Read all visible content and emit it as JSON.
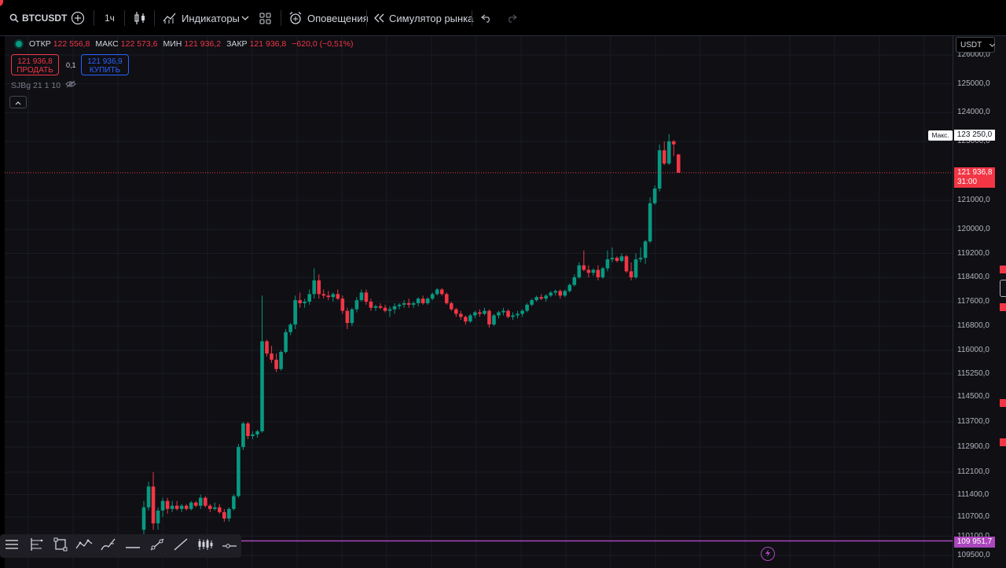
{
  "toolbar": {
    "symbol": "BTCUSDT",
    "interval": "1ч",
    "indicators_label": "Индикаторы",
    "alerts_label": "Оповещения",
    "replay_label": "Симулятор рынка"
  },
  "ohlc": {
    "open_label": "ОТКР",
    "open": "122 556,8",
    "high_label": "МАКС",
    "high": "122 573,6",
    "low_label": "МИН",
    "low": "121 936,2",
    "close_label": "ЗАКР",
    "close": "121 936,8",
    "change": "−620,0 (−0,51%)"
  },
  "trade": {
    "sell_price": "121 936,8",
    "sell_label": "ПРОДАТЬ",
    "spread": "0,1",
    "buy_price": "121 936,9",
    "buy_label": "КУПИТЬ"
  },
  "indicator_legend": "SJBg 21 1 10",
  "currency": "USDT",
  "price_axis": {
    "ticks": [
      "126000,0",
      "125000,0",
      "124000,0",
      "123000,0",
      "121000,0",
      "120000,0",
      "119200,0",
      "118400,0",
      "117600,0",
      "116800,0",
      "116000,0",
      "115250,0",
      "114500,0",
      "113700,0",
      "112900,0",
      "112100,0",
      "111400,0",
      "110700,0",
      "110100,0",
      "109500,0"
    ],
    "tick_values": [
      126000,
      125000,
      124000,
      123000,
      121000,
      120000,
      119200,
      118400,
      117600,
      116800,
      116000,
      115250,
      114500,
      113700,
      112900,
      112100,
      111400,
      110700,
      110100,
      109500
    ],
    "max_label": "Макс.",
    "max_value": "123 250,0",
    "current_price": "121 936,8",
    "countdown": "31:00",
    "horizontal_line_price": "109 951,7"
  },
  "colors": {
    "up": "#089981",
    "down": "#f23645",
    "horizontal_line": "#ab47bc",
    "background": "#0f0f14"
  },
  "drawing_tools": [
    "menu-icon",
    "fib-icon",
    "rectangle-icon",
    "path-icon",
    "brush-icon",
    "horizontal-line-icon",
    "trend-line-icon",
    "ray-icon",
    "pattern-icon",
    "horizontal-ray-icon"
  ],
  "chart_data": {
    "type": "candlestick",
    "interval": "1h",
    "symbol": "BTCUSDT",
    "ylim": [
      109400,
      126300
    ],
    "candles": [
      [
        110300,
        111200,
        110100,
        111000
      ],
      [
        111000,
        111800,
        110900,
        111650
      ],
      [
        111650,
        112100,
        110300,
        110500
      ],
      [
        110500,
        111000,
        110300,
        110900
      ],
      [
        110900,
        111300,
        110700,
        111200
      ],
      [
        111200,
        111300,
        110800,
        110950
      ],
      [
        110950,
        111200,
        110850,
        111050
      ],
      [
        111050,
        111200,
        110900,
        110950
      ],
      [
        110950,
        111100,
        110850,
        111050
      ],
      [
        111050,
        111100,
        110900,
        110950
      ],
      [
        110950,
        111200,
        110900,
        111150
      ],
      [
        111150,
        111200,
        111000,
        111050
      ],
      [
        111050,
        111400,
        110950,
        111300
      ],
      [
        111300,
        111350,
        111000,
        111050
      ],
      [
        111050,
        111100,
        110850,
        110950
      ],
      [
        110950,
        111150,
        110900,
        111000
      ],
      [
        111000,
        111100,
        110800,
        110850
      ],
      [
        110850,
        110950,
        110550,
        110650
      ],
      [
        110650,
        111000,
        110550,
        110950
      ],
      [
        110950,
        111400,
        110900,
        111350
      ],
      [
        111350,
        113000,
        111300,
        112900
      ],
      [
        112900,
        113700,
        112800,
        113650
      ],
      [
        113650,
        113700,
        113150,
        113250
      ],
      [
        113250,
        113400,
        113150,
        113300
      ],
      [
        113300,
        113450,
        113200,
        113400
      ],
      [
        113400,
        117800,
        113350,
        116300
      ],
      [
        116300,
        116350,
        115800,
        115900
      ],
      [
        115900,
        116150,
        115600,
        115700
      ],
      [
        115700,
        115900,
        115300,
        115400
      ],
      [
        115400,
        116000,
        115350,
        115950
      ],
      [
        115950,
        116700,
        115900,
        116600
      ],
      [
        116600,
        116900,
        116500,
        116850
      ],
      [
        116850,
        117800,
        116700,
        117650
      ],
      [
        117650,
        117900,
        117400,
        117550
      ],
      [
        117550,
        117700,
        117400,
        117600
      ],
      [
        117600,
        118000,
        117500,
        117850
      ],
      [
        117850,
        118700,
        117700,
        118300
      ],
      [
        118300,
        118500,
        117700,
        117850
      ],
      [
        117850,
        118000,
        117700,
        117800
      ],
      [
        117800,
        117950,
        117650,
        117750
      ],
      [
        117750,
        117900,
        117600,
        117850
      ],
      [
        117850,
        118000,
        117650,
        117700
      ],
      [
        117700,
        117800,
        117200,
        117300
      ],
      [
        117300,
        117400,
        116700,
        116900
      ],
      [
        116900,
        117400,
        116800,
        117350
      ],
      [
        117350,
        117750,
        117250,
        117650
      ],
      [
        117650,
        118000,
        117600,
        117900
      ],
      [
        117900,
        118000,
        117500,
        117600
      ],
      [
        117600,
        117700,
        117300,
        117400
      ],
      [
        117400,
        117500,
        117300,
        117450
      ],
      [
        117450,
        117550,
        117350,
        117400
      ],
      [
        117400,
        117500,
        117250,
        117300
      ],
      [
        117300,
        117450,
        117100,
        117350
      ],
      [
        117350,
        117550,
        117200,
        117450
      ],
      [
        117450,
        117550,
        117350,
        117500
      ],
      [
        117500,
        117650,
        117400,
        117550
      ],
      [
        117550,
        117700,
        117400,
        117500
      ],
      [
        117500,
        117600,
        117400,
        117550
      ],
      [
        117550,
        117750,
        117450,
        117700
      ],
      [
        117700,
        117800,
        117500,
        117550
      ],
      [
        117550,
        117750,
        117500,
        117700
      ],
      [
        117700,
        117900,
        117650,
        117850
      ],
      [
        117850,
        118050,
        117800,
        118000
      ],
      [
        118000,
        118050,
        117800,
        117850
      ],
      [
        117850,
        117900,
        117500,
        117550
      ],
      [
        117550,
        117600,
        117300,
        117350
      ],
      [
        117350,
        117400,
        117100,
        117200
      ],
      [
        117200,
        117300,
        117000,
        117100
      ],
      [
        117100,
        117150,
        116850,
        116950
      ],
      [
        116950,
        117200,
        116900,
        117150
      ],
      [
        117150,
        117300,
        117050,
        117250
      ],
      [
        117250,
        117350,
        117100,
        117200
      ],
      [
        117200,
        117400,
        117150,
        117300
      ],
      [
        117300,
        117350,
        116750,
        116850
      ],
      [
        116850,
        117200,
        116800,
        117150
      ],
      [
        117150,
        117300,
        117050,
        117250
      ],
      [
        117250,
        117400,
        117150,
        117300
      ],
      [
        117300,
        117350,
        117050,
        117100
      ],
      [
        117100,
        117250,
        117000,
        117150
      ],
      [
        117150,
        117300,
        117050,
        117200
      ],
      [
        117200,
        117350,
        117100,
        117300
      ],
      [
        117300,
        117550,
        117250,
        117500
      ],
      [
        117500,
        117700,
        117450,
        117650
      ],
      [
        117650,
        117800,
        117600,
        117750
      ],
      [
        117750,
        117850,
        117650,
        117700
      ],
      [
        117700,
        117850,
        117600,
        117800
      ],
      [
        117800,
        117950,
        117750,
        117900
      ],
      [
        117900,
        118000,
        117800,
        117950
      ],
      [
        117950,
        118000,
        117700,
        117800
      ],
      [
        117800,
        118000,
        117750,
        117950
      ],
      [
        117950,
        118200,
        117900,
        118150
      ],
      [
        118150,
        118500,
        118100,
        118400
      ],
      [
        118400,
        118900,
        118350,
        118800
      ],
      [
        118800,
        119300,
        118600,
        118650
      ],
      [
        118650,
        118800,
        118400,
        118550
      ],
      [
        118550,
        118700,
        118450,
        118650
      ],
      [
        118650,
        118800,
        118300,
        118400
      ],
      [
        118400,
        118750,
        118350,
        118700
      ],
      [
        118700,
        119300,
        118600,
        119000
      ],
      [
        119000,
        119400,
        118900,
        119050
      ],
      [
        119050,
        119100,
        118900,
        118950
      ],
      [
        118950,
        119200,
        118900,
        119100
      ],
      [
        119100,
        119150,
        118550,
        118600
      ],
      [
        118600,
        118900,
        118300,
        118400
      ],
      [
        118400,
        119200,
        118350,
        119000
      ],
      [
        119000,
        119400,
        118900,
        119050
      ],
      [
        119050,
        119650,
        118850,
        119600
      ],
      [
        119600,
        121100,
        119550,
        120900
      ],
      [
        120900,
        121500,
        120850,
        121400
      ],
      [
        121400,
        122900,
        121300,
        122700
      ],
      [
        122700,
        123000,
        122200,
        122250
      ],
      [
        122250,
        123250,
        122200,
        123000
      ],
      [
        123000,
        123050,
        122500,
        122900
      ],
      [
        122556.8,
        122573.6,
        121936.2,
        121936.8
      ]
    ]
  }
}
